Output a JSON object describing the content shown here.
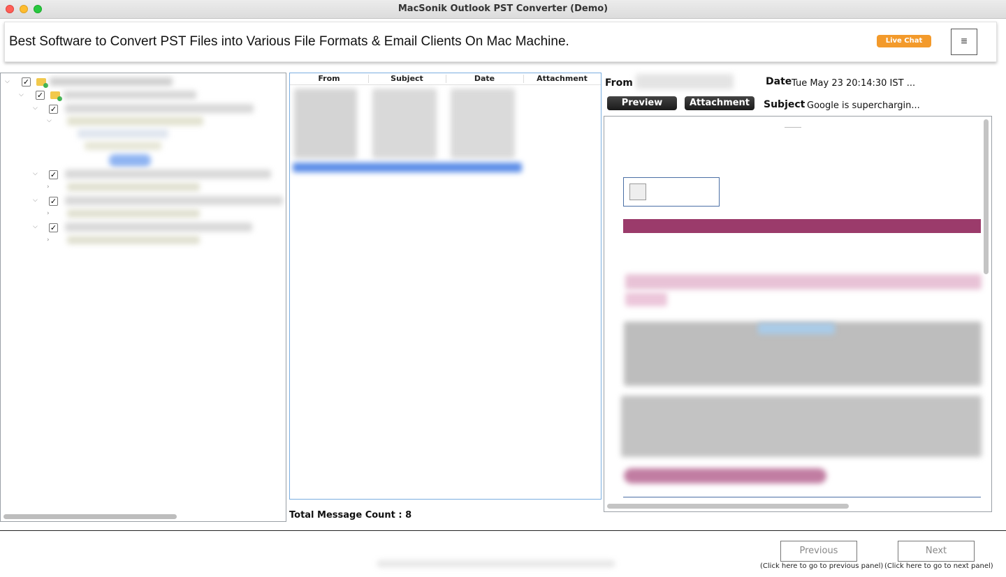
{
  "window": {
    "title": "MacSonik Outlook PST Converter (Demo)"
  },
  "banner": {
    "text": "Best Software to Convert PST Files into Various File Formats & Email Clients On Mac Machine.",
    "live_chat": "Live Chat",
    "menu_icon": "≡"
  },
  "message_list": {
    "columns": [
      "From",
      "Subject",
      "Date",
      "Attachment"
    ],
    "total_label": "Total Message Count : 8"
  },
  "details": {
    "from_label": "From",
    "date_label": "Date",
    "date_value": "Tue May 23 20:14:30 IST ...",
    "subject_label": "Subject",
    "subject_value": "Google is superchargin...",
    "preview_tab": "Preview",
    "attachment_tab": "Attachment"
  },
  "footer": {
    "previous": "Previous",
    "previous_hint": "(Click here to go to previous panel)",
    "next": "Next",
    "next_hint": "(Click here to go to next panel)"
  },
  "colors": {
    "accent_orange": "#f39a2b",
    "email_banner": "#9b3b6b",
    "selection_blue": "#3b82f6"
  }
}
